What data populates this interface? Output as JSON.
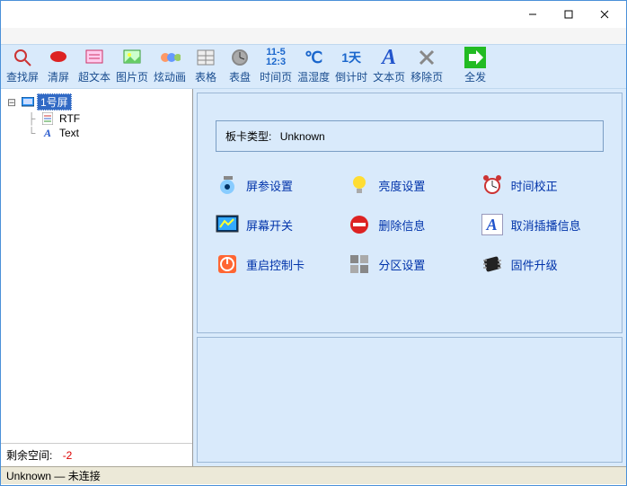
{
  "titlebar": {
    "min": "",
    "max": "",
    "close": ""
  },
  "toolbar": [
    {
      "id": "find-screen",
      "label": "查找屏"
    },
    {
      "id": "clear-screen",
      "label": "清屏"
    },
    {
      "id": "hypertext",
      "label": "超文本"
    },
    {
      "id": "image-page",
      "label": "图片页"
    },
    {
      "id": "animation",
      "label": "炫动画"
    },
    {
      "id": "table",
      "label": "表格"
    },
    {
      "id": "dial",
      "label": "表盘"
    },
    {
      "id": "time-page",
      "label": "时间页"
    },
    {
      "id": "temp-humid",
      "label": "温湿度"
    },
    {
      "id": "countdown",
      "label": "倒计时"
    },
    {
      "id": "text-page",
      "label": "文本页"
    },
    {
      "id": "remove-page",
      "label": "移除页"
    },
    {
      "id": "send-all",
      "label": "全发"
    }
  ],
  "toolbar_icon_text": {
    "time-page": "11-5\n12:3",
    "temp-humid": "℃",
    "countdown": "1天"
  },
  "tree": {
    "root": "1号屏",
    "children": [
      {
        "label": "RTF",
        "icon": "rtf"
      },
      {
        "label": "Text",
        "icon": "text"
      }
    ]
  },
  "remaining": {
    "label": "剩余空间:",
    "value": "-2"
  },
  "card": {
    "label": "板卡类型:",
    "value": "Unknown"
  },
  "ops": [
    {
      "id": "screen-params",
      "label": "屏参设置"
    },
    {
      "id": "brightness",
      "label": "亮度设置"
    },
    {
      "id": "time-correct",
      "label": "时间校正"
    },
    {
      "id": "screen-switch",
      "label": "屏幕开关"
    },
    {
      "id": "delete-info",
      "label": "删除信息"
    },
    {
      "id": "cancel-interrupt",
      "label": "取消插播信息"
    },
    {
      "id": "restart-card",
      "label": "重启控制卡"
    },
    {
      "id": "zone-setting",
      "label": "分区设置"
    },
    {
      "id": "firmware-upgrade",
      "label": "固件升级"
    }
  ],
  "status": {
    "device": "Unknown",
    "sep": "—",
    "conn": "未连接"
  }
}
